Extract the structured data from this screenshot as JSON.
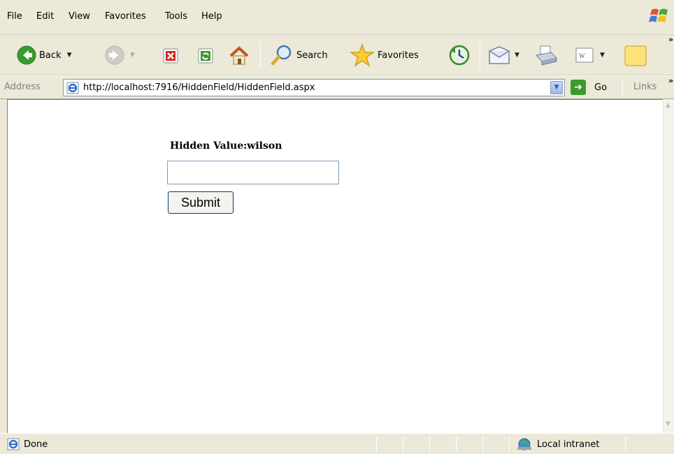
{
  "menu": {
    "items": [
      "File",
      "Edit",
      "View",
      "Favorites",
      "Tools",
      "Help"
    ]
  },
  "toolbar": {
    "back_label": "Back",
    "search_label": "Search",
    "favorites_label": "Favorites",
    "icons": [
      "back-icon",
      "forward-icon",
      "stop-icon",
      "refresh-icon",
      "home-icon",
      "search-icon",
      "favorites-star-icon",
      "history-icon",
      "mail-icon",
      "print-icon",
      "edit-document-icon",
      "sticky-note-icon"
    ]
  },
  "address": {
    "label": "Address",
    "url": "http://localhost:7916/HiddenField/HiddenField.aspx",
    "go_label": "Go",
    "links_label": "Links"
  },
  "page": {
    "hidden_value_text": "Hidden Value:wilson",
    "input_value": "",
    "submit_label": "Submit"
  },
  "status": {
    "text": "Done",
    "zone": "Local intranet"
  },
  "colors": {
    "chrome": "#ece9d8",
    "input_border": "#7f9db9",
    "button_border": "#003c74"
  }
}
